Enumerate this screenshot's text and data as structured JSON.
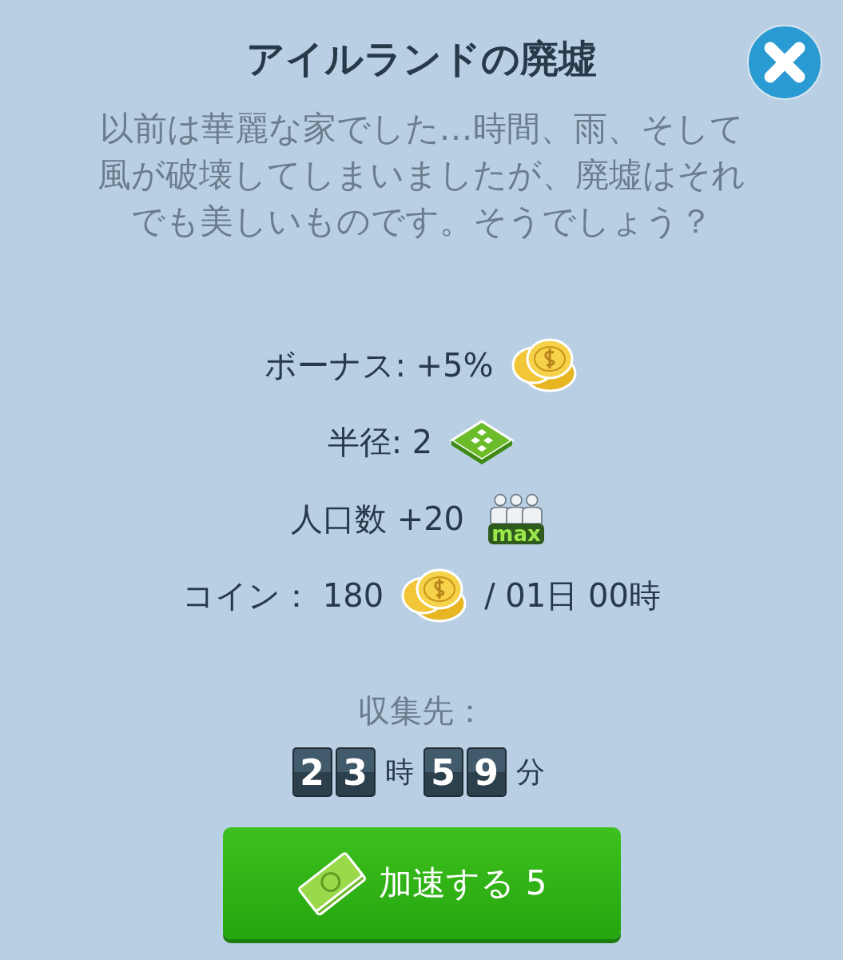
{
  "title": "アイルランドの廃墟",
  "description": "以前は華麗な家でした…時間、雨、そして風が破壊してしまいましたが、廃墟はそれでも美しいものです。そうでしょう？",
  "stats": [
    {
      "kind": "coins",
      "label": "ボーナス: +5%"
    },
    {
      "kind": "radius",
      "label": "半径: 2"
    },
    {
      "kind": "population",
      "label": "人口数 +20",
      "badge": "max"
    },
    {
      "kind": "coins",
      "label": "コイン： 180",
      "suffix": "/ 01日 00時"
    }
  ],
  "collect_label": "収集先：",
  "timer": [
    {
      "kind": "digit",
      "text": "2"
    },
    {
      "kind": "digit",
      "text": "3"
    },
    {
      "kind": "unit",
      "text": "時"
    },
    {
      "kind": "digit",
      "text": "5"
    },
    {
      "kind": "digit",
      "text": "9"
    },
    {
      "kind": "unit",
      "text": "分"
    }
  ],
  "speedup_button": {
    "label": "加速する 5"
  }
}
